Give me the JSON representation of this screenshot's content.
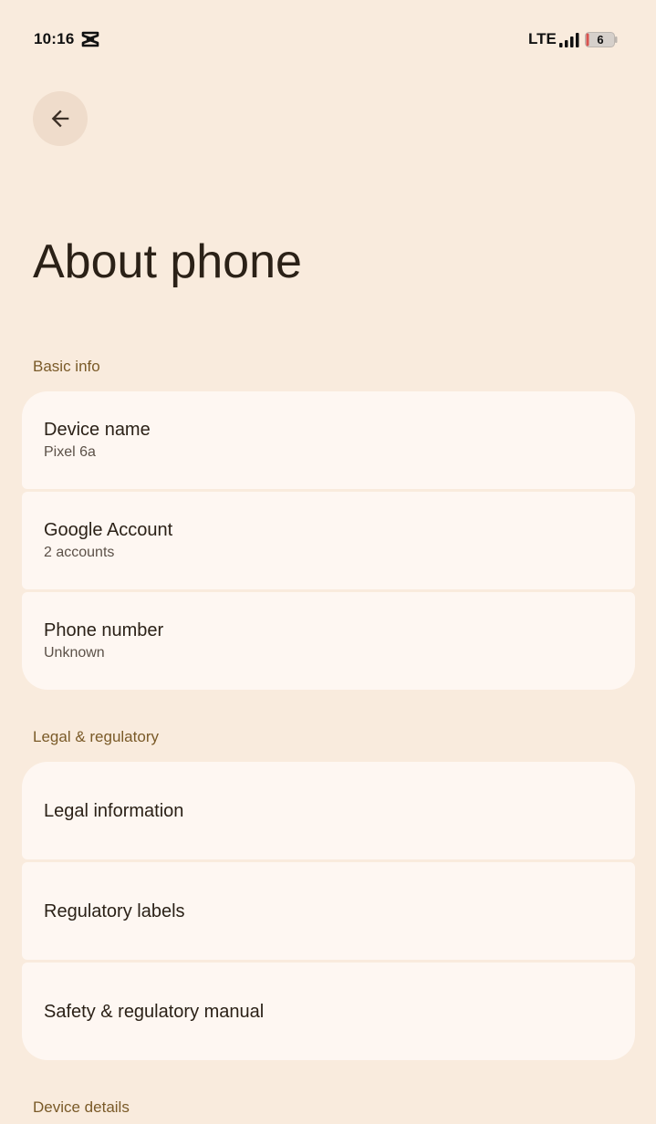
{
  "status_bar": {
    "time": "10:16",
    "network": "LTE",
    "battery_level": "6",
    "app_icon": "capcut-icon",
    "signal_icon": "cellular-signal-icon",
    "battery_icon": "battery-low-icon"
  },
  "header": {
    "back_icon": "arrow-back-icon",
    "title": "About phone"
  },
  "sections": {
    "basic_info": {
      "title": "Basic info",
      "items": [
        {
          "label": "Device name",
          "value": "Pixel 6a"
        },
        {
          "label": "Google Account",
          "value": "2 accounts"
        },
        {
          "label": "Phone number",
          "value": "Unknown"
        }
      ]
    },
    "legal": {
      "title": "Legal & regulatory",
      "items": [
        {
          "label": "Legal information"
        },
        {
          "label": "Regulatory labels"
        },
        {
          "label": "Safety & regulatory manual"
        }
      ]
    },
    "device_details": {
      "title": "Device details"
    }
  },
  "colors": {
    "background": "#f9ebdd",
    "card": "#fef7f2",
    "section_header": "#7a5a28",
    "back_button_bg": "#efdccb",
    "battery_low": "#d9534f"
  }
}
